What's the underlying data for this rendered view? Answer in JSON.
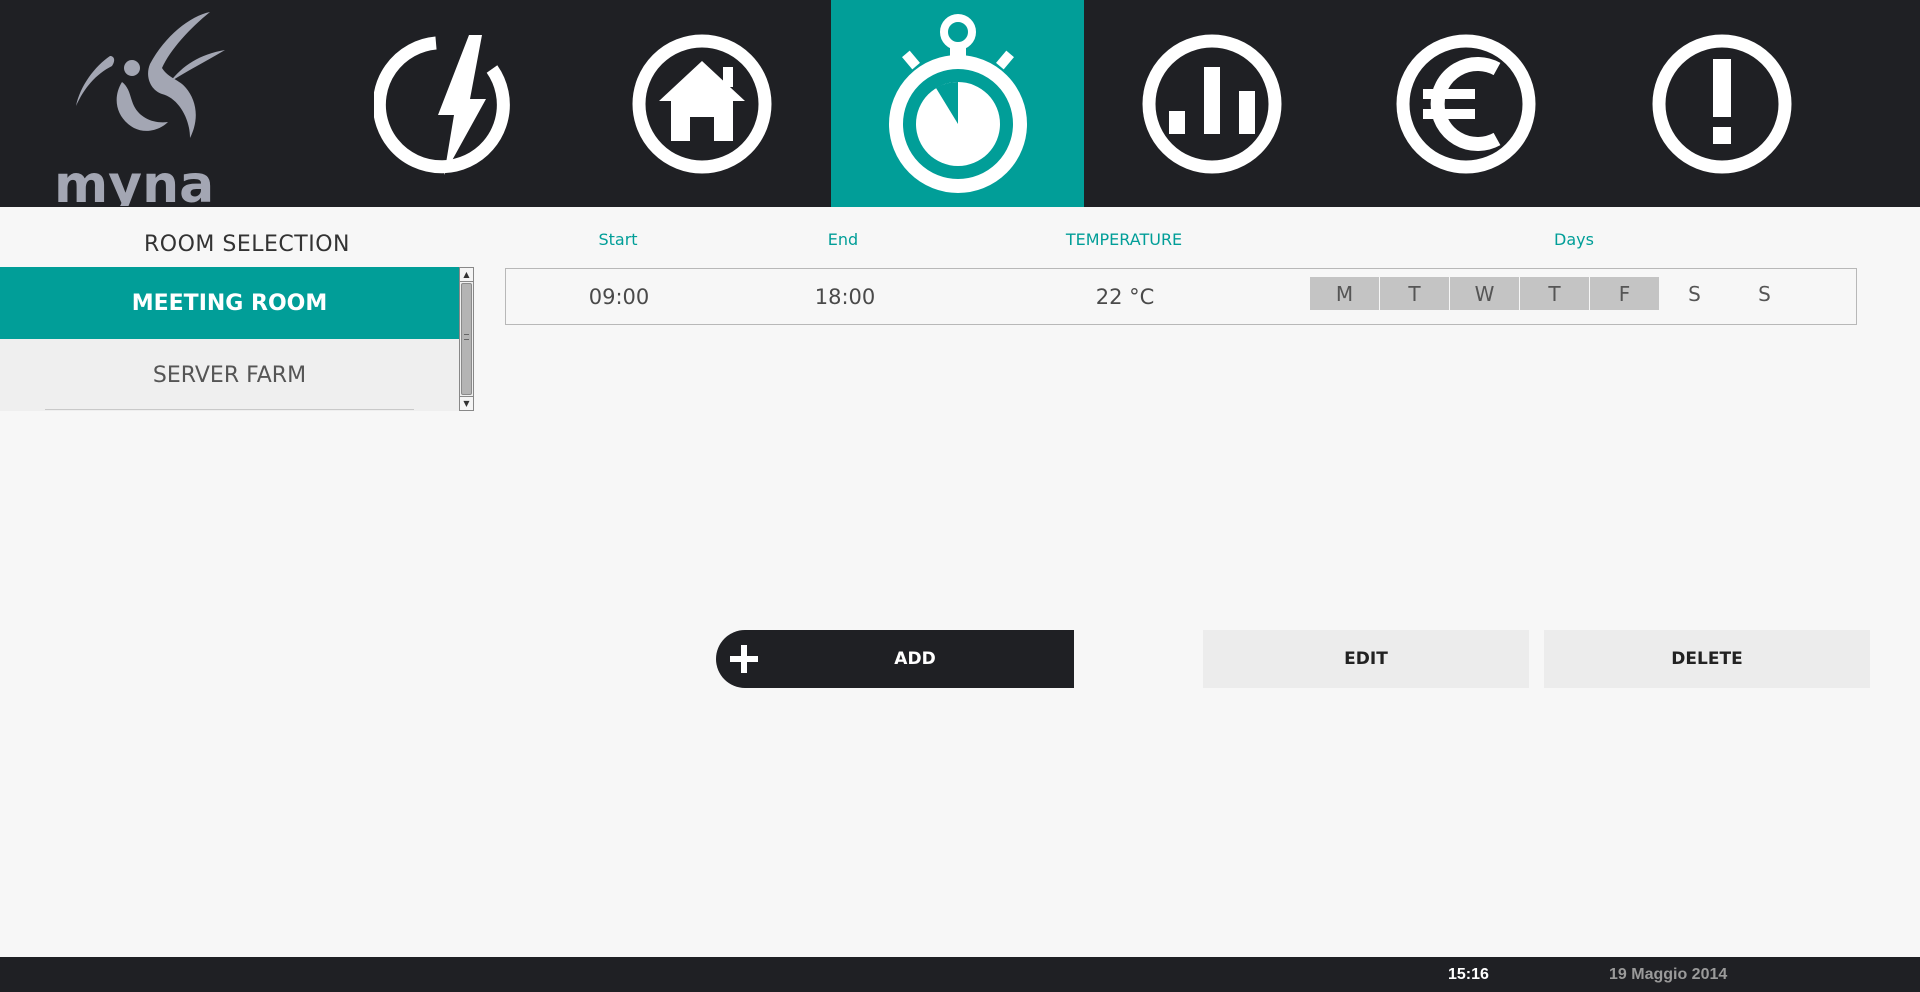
{
  "app": {
    "logo_text": "myna",
    "accent_color": "#019e98",
    "dark_color": "#1f2024"
  },
  "nav": {
    "items": [
      {
        "icon": "power-bolt-icon",
        "active": false
      },
      {
        "icon": "home-icon",
        "active": false
      },
      {
        "icon": "stopwatch-icon",
        "active": true
      },
      {
        "icon": "bar-chart-icon",
        "active": false
      },
      {
        "icon": "euro-icon",
        "active": false
      },
      {
        "icon": "alert-icon",
        "active": false
      }
    ]
  },
  "sidebar": {
    "title": "ROOM SELECTION",
    "rooms": [
      {
        "label": "MEETING ROOM",
        "selected": true
      },
      {
        "label": "SERVER FARM",
        "selected": false
      }
    ]
  },
  "schedule": {
    "headers": {
      "start": "Start",
      "end": "End",
      "temperature": "TEMPERATURE",
      "days": "Days"
    },
    "rows": [
      {
        "start": "09:00",
        "end": "18:00",
        "temperature": "22 °C",
        "days": [
          {
            "label": "M",
            "on": true
          },
          {
            "label": "T",
            "on": true
          },
          {
            "label": "W",
            "on": true
          },
          {
            "label": "T",
            "on": true
          },
          {
            "label": "F",
            "on": true
          },
          {
            "label": "S",
            "on": false
          },
          {
            "label": "S",
            "on": false
          }
        ]
      }
    ]
  },
  "actions": {
    "add_label": "ADD",
    "edit_label": "EDIT",
    "delete_label": "DELETE"
  },
  "footer": {
    "time": "15:16",
    "date": "19 Maggio 2014"
  }
}
